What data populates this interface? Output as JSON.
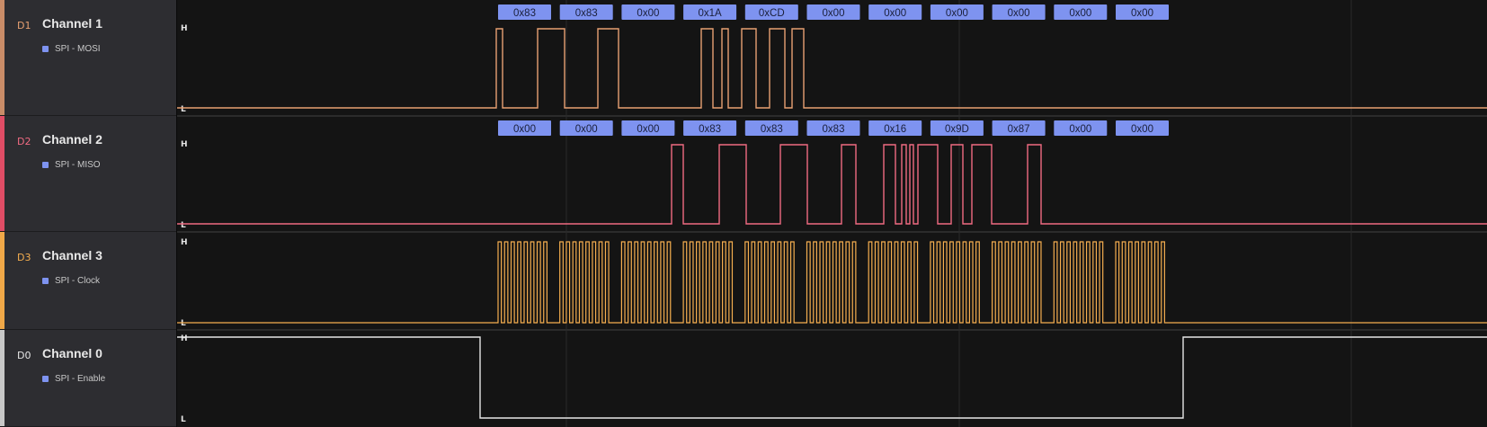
{
  "colors": {
    "background": "#141414",
    "sidebar": "#2d2d31",
    "bubble_fill": "#7e93f0",
    "bubble_text": "#1a1f3a",
    "grid": "#2a2a2a"
  },
  "level_labels": {
    "high": "H",
    "low": "L"
  },
  "channels": [
    {
      "id": "D1",
      "name": "Channel 1",
      "analyzer": "SPI - MOSI",
      "color": "#e8a072",
      "stripe": "#c98c68",
      "bytes": [
        "0x83",
        "0x83",
        "0x00",
        "0x1A",
        "0xCD",
        "0x00",
        "0x00",
        "0x00",
        "0x00",
        "0x00",
        "0x00"
      ]
    },
    {
      "id": "D2",
      "name": "Channel 2",
      "analyzer": "SPI - MISO",
      "color": "#f06b82",
      "stripe": "#e04d66",
      "bytes": [
        "0x00",
        "0x00",
        "0x00",
        "0x83",
        "0x83",
        "0x83",
        "0x16",
        "0x9D",
        "0x87",
        "0x00",
        "0x00"
      ]
    },
    {
      "id": "D3",
      "name": "Channel 3",
      "analyzer": "SPI - Clock",
      "color": "#f5ae4f",
      "stripe": "#f0a848",
      "bytes": []
    },
    {
      "id": "D0",
      "name": "Channel 0",
      "analyzer": "SPI - Enable",
      "color": "#e6e6e6",
      "stripe": "#c8c8c8",
      "bytes": []
    }
  ]
}
